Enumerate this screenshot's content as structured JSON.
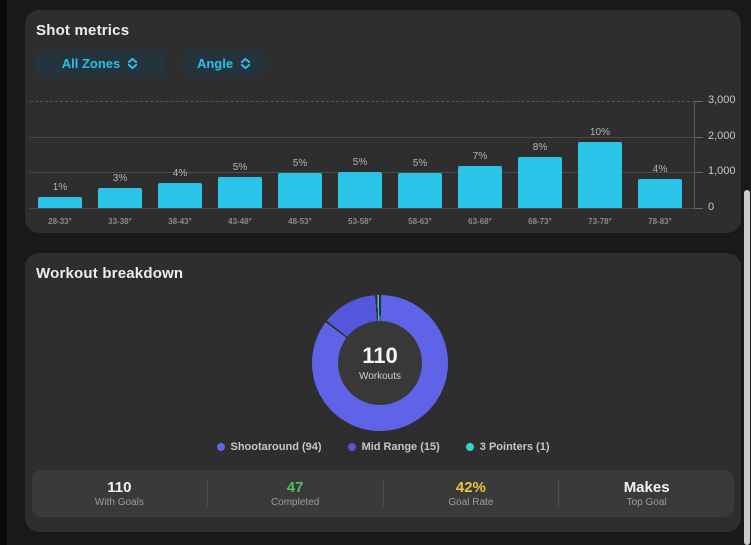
{
  "shot_metrics": {
    "title": "Shot metrics",
    "filters": [
      {
        "label": "All Zones",
        "icon": "sort-updown-icon"
      },
      {
        "label": "Angle",
        "icon": "sort-updown-icon"
      }
    ]
  },
  "workout_breakdown": {
    "title": "Workout breakdown",
    "center_value": "110",
    "center_label": "Workouts",
    "stats": [
      {
        "value": "110",
        "label": "With Goals",
        "color": "#F2F2F2"
      },
      {
        "value": "47",
        "label": "Completed",
        "color": "#4BC25B"
      },
      {
        "value": "42%",
        "label": "Goal Rate",
        "color": "#E9C83B"
      },
      {
        "value": "Makes",
        "label": "Top Goal",
        "color": "#F2F2F2"
      }
    ]
  },
  "chart_data": [
    {
      "type": "bar",
      "title": "Shot metrics",
      "categories": [
        "28-33°",
        "33-38°",
        "38-43°",
        "43-48°",
        "48-53°",
        "53-58°",
        "58-63°",
        "63-68°",
        "68-73°",
        "73-78°",
        "78-83°"
      ],
      "values": [
        300,
        550,
        690,
        880,
        980,
        1000,
        980,
        1180,
        1430,
        1850,
        810
      ],
      "bar_labels": [
        "1%",
        "3%",
        "4%",
        "5%",
        "5%",
        "5%",
        "5%",
        "7%",
        "8%",
        "10%",
        "4%"
      ],
      "xlabel": "",
      "ylabel": "",
      "ylim": [
        0,
        3000
      ],
      "y_ticks": [
        {
          "value": 3000,
          "label": "3,000",
          "dashed": true
        },
        {
          "value": 2000,
          "label": "2,000",
          "dashed": false
        },
        {
          "value": 1000,
          "label": "1,000",
          "dashed": false
        },
        {
          "value": 0,
          "label": "0",
          "dashed": false
        }
      ],
      "bar_color": "#2BC3E8",
      "grid": "horizontal",
      "legend_position": "none"
    },
    {
      "type": "pie",
      "donut": true,
      "title": "Workout breakdown",
      "center_value": "110",
      "center_label": "Workouts",
      "segments": [
        {
          "name": "Shootaround",
          "value": 94,
          "color": "#5F63E8"
        },
        {
          "name": "Mid Range",
          "value": 15,
          "color": "#5457DC"
        },
        {
          "name": "3 Pointers",
          "value": 1,
          "color": "#38D3C8"
        }
      ],
      "legend_position": "bottom"
    }
  ],
  "colors": {
    "page_bg": "#191919",
    "card_bg": "#2E2E2E",
    "bar": "#2BC3E8",
    "button_bg": "#25333C",
    "button_text": "#2BC0E8",
    "gridline": "#4B4B4B",
    "axis_text": "#C8C8C8",
    "stats_bg": "#3A3A3A",
    "donut_gap": "#2E2E2E"
  }
}
